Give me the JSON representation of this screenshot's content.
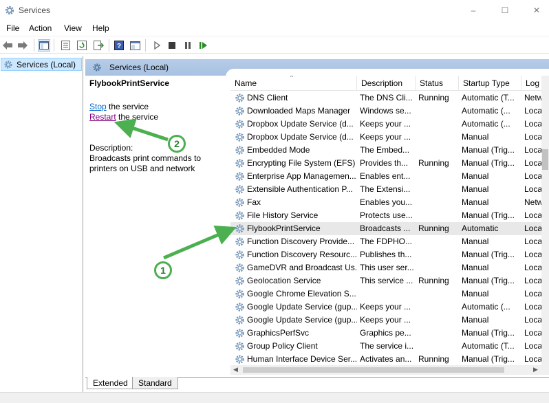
{
  "window": {
    "title": "Services",
    "icon": "gear-icon",
    "controls": {
      "minimize": "–",
      "maximize": "☐",
      "close": "✕"
    }
  },
  "menu": [
    "File",
    "Action",
    "View",
    "Help"
  ],
  "toolbar": {
    "icons": [
      "back-arrow-icon",
      "forward-arrow-icon",
      "show-tree-icon",
      "properties-icon",
      "refresh-icon",
      "export-list-icon",
      "help-icon",
      "console-icon",
      "play-icon",
      "stop-icon",
      "pause-icon",
      "resume-icon"
    ]
  },
  "tree": {
    "selected": "Services (Local)"
  },
  "content": {
    "header": "Services (Local)",
    "selected_service": "FlybookPrintService",
    "actions": [
      {
        "link": "Stop",
        "suffix": " the service"
      },
      {
        "link": "Restart",
        "suffix": " the service"
      }
    ],
    "description_label": "Description:",
    "description_text": "Broadcasts print commands to printers on USB and network"
  },
  "list": {
    "columns": [
      "Name",
      "Description",
      "Status",
      "Startup Type",
      "Log"
    ],
    "sort_indicator": "^",
    "rows": [
      {
        "name": "DNS Client",
        "desc": "The DNS Cli...",
        "status": "Running",
        "startup": "Automatic (T...",
        "logon": "Netw"
      },
      {
        "name": "Downloaded Maps Manager",
        "desc": "Windows se...",
        "status": "",
        "startup": "Automatic (...",
        "logon": "Loca"
      },
      {
        "name": "Dropbox Update Service (d...",
        "desc": "Keeps your ...",
        "status": "",
        "startup": "Automatic (...",
        "logon": "Loca"
      },
      {
        "name": "Dropbox Update Service (d...",
        "desc": "Keeps your ...",
        "status": "",
        "startup": "Manual",
        "logon": "Loca"
      },
      {
        "name": "Embedded Mode",
        "desc": "The Embed...",
        "status": "",
        "startup": "Manual (Trig...",
        "logon": "Loca"
      },
      {
        "name": "Encrypting File System (EFS)",
        "desc": "Provides th...",
        "status": "Running",
        "startup": "Manual (Trig...",
        "logon": "Loca"
      },
      {
        "name": "Enterprise App Managemen...",
        "desc": "Enables ent...",
        "status": "",
        "startup": "Manual",
        "logon": "Loca"
      },
      {
        "name": "Extensible Authentication P...",
        "desc": "The Extensi...",
        "status": "",
        "startup": "Manual",
        "logon": "Loca"
      },
      {
        "name": "Fax",
        "desc": "Enables you...",
        "status": "",
        "startup": "Manual",
        "logon": "Netw"
      },
      {
        "name": "File History Service",
        "desc": "Protects use...",
        "status": "",
        "startup": "Manual (Trig...",
        "logon": "Loca"
      },
      {
        "name": "FlybookPrintService",
        "desc": "Broadcasts ...",
        "status": "Running",
        "startup": "Automatic",
        "logon": "Loca",
        "selected": true
      },
      {
        "name": "Function Discovery Provide...",
        "desc": "The FDPHO...",
        "status": "",
        "startup": "Manual",
        "logon": "Loca"
      },
      {
        "name": "Function Discovery Resourc...",
        "desc": "Publishes th...",
        "status": "",
        "startup": "Manual (Trig...",
        "logon": "Loca"
      },
      {
        "name": "GameDVR and Broadcast Us...",
        "desc": "This user ser...",
        "status": "",
        "startup": "Manual",
        "logon": "Loca"
      },
      {
        "name": "Geolocation Service",
        "desc": "This service ...",
        "status": "Running",
        "startup": "Manual (Trig...",
        "logon": "Loca"
      },
      {
        "name": "Google Chrome Elevation S...",
        "desc": "",
        "status": "",
        "startup": "Manual",
        "logon": "Loca"
      },
      {
        "name": "Google Update Service (gup...",
        "desc": "Keeps your ...",
        "status": "",
        "startup": "Automatic (...",
        "logon": "Loca"
      },
      {
        "name": "Google Update Service (gup...",
        "desc": "Keeps your ...",
        "status": "",
        "startup": "Manual",
        "logon": "Loca"
      },
      {
        "name": "GraphicsPerfSvc",
        "desc": "Graphics pe...",
        "status": "",
        "startup": "Manual (Trig...",
        "logon": "Loca"
      },
      {
        "name": "Group Policy Client",
        "desc": "The service i...",
        "status": "",
        "startup": "Automatic (T...",
        "logon": "Loca"
      },
      {
        "name": "Human Interface Device Ser...",
        "desc": "Activates an...",
        "status": "Running",
        "startup": "Manual (Trig...",
        "logon": "Loca"
      }
    ]
  },
  "tabs": [
    "Extended",
    "Standard"
  ],
  "annotations": [
    {
      "label": "1",
      "color": "#4caf50"
    },
    {
      "label": "2",
      "color": "#4caf50"
    }
  ]
}
